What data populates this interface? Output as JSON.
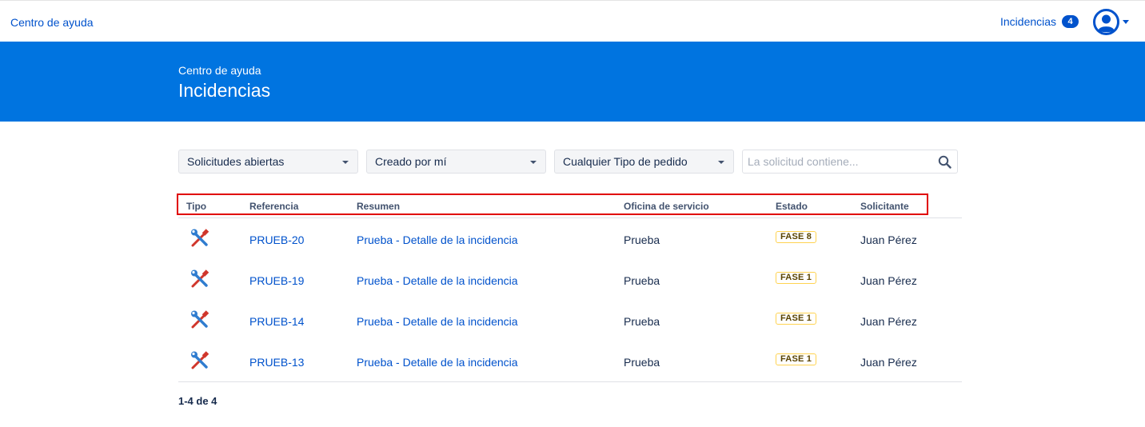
{
  "topbar": {
    "brand": "Centro de ayuda",
    "issues_label": "Incidencias",
    "issues_count": "4"
  },
  "banner": {
    "subtitle": "Centro de ayuda",
    "title": "Incidencias"
  },
  "filters": {
    "status": "Solicitudes abiertas",
    "created": "Creado por mí",
    "request_type": "Cualquier Tipo de pedido",
    "search_placeholder": "La solicitud contiene..."
  },
  "table": {
    "headers": {
      "tipo": "Tipo",
      "referencia": "Referencia",
      "resumen": "Resumen",
      "oficina": "Oficina de servicio",
      "estado": "Estado",
      "solicitante": "Solicitante"
    },
    "rows": [
      {
        "type_icon": "wrench-screwdriver-icon",
        "ref": "PRUEB-20",
        "summary": "Prueba - Detalle de la incidencia",
        "office": "Prueba",
        "status": "FASE 8",
        "requester": "Juan Pérez"
      },
      {
        "type_icon": "wrench-screwdriver-icon",
        "ref": "PRUEB-19",
        "summary": "Prueba - Detalle de la incidencia",
        "office": "Prueba",
        "status": "FASE 1",
        "requester": "Juan Pérez"
      },
      {
        "type_icon": "wrench-screwdriver-icon",
        "ref": "PRUEB-14",
        "summary": "Prueba - Detalle de la incidencia",
        "office": "Prueba",
        "status": "FASE 1",
        "requester": "Juan Pérez"
      },
      {
        "type_icon": "wrench-screwdriver-icon",
        "ref": "PRUEB-13",
        "summary": "Prueba - Detalle de la incidencia",
        "office": "Prueba",
        "status": "FASE 1",
        "requester": "Juan Pérez"
      }
    ]
  },
  "pagination": "1-4 de 4",
  "colors": {
    "brand_blue": "#0074e0",
    "link_blue": "#0052cc",
    "highlight_red": "#e00000",
    "lozenge_border": "#ffd351"
  }
}
